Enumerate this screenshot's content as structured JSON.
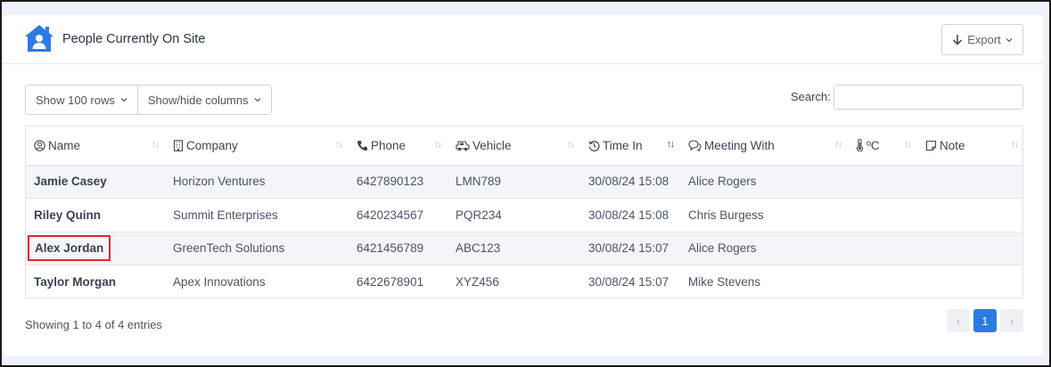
{
  "header": {
    "title": "People Currently On Site",
    "logo_icon": "house-person-icon",
    "export_label": "Export"
  },
  "toolbar": {
    "rows_label": "Show 100 rows",
    "columns_label": "Show/hide columns",
    "search_label": "Search:",
    "search_value": ""
  },
  "table": {
    "columns": [
      {
        "label": "Name",
        "icon": "person-circle-icon"
      },
      {
        "label": "Company",
        "icon": "building-icon"
      },
      {
        "label": "Phone",
        "icon": "phone-icon"
      },
      {
        "label": "Vehicle",
        "icon": "truck-icon"
      },
      {
        "label": "Time In",
        "icon": "history-icon"
      },
      {
        "label": "Meeting With",
        "icon": "chat-icon"
      },
      {
        "label": "ºC",
        "icon": "thermometer-icon"
      },
      {
        "label": "Note",
        "icon": "note-icon"
      }
    ],
    "rows": [
      {
        "name": "Jamie Casey",
        "company": "Horizon Ventures",
        "phone": "6427890123",
        "vehicle": "LMN789",
        "time_in": "30/08/24 15:08",
        "meeting_with": "Alice Rogers",
        "temp": "",
        "note": ""
      },
      {
        "name": "Riley Quinn",
        "company": "Summit Enterprises",
        "phone": "6420234567",
        "vehicle": "PQR234",
        "time_in": "30/08/24 15:08",
        "meeting_with": "Chris Burgess",
        "temp": "",
        "note": ""
      },
      {
        "name": "Alex Jordan",
        "company": "GreenTech Solutions",
        "phone": "6421456789",
        "vehicle": "ABC123",
        "time_in": "30/08/24 15:07",
        "meeting_with": "Alice Rogers",
        "temp": "",
        "note": ""
      },
      {
        "name": "Taylor Morgan",
        "company": "Apex Innovations",
        "phone": "6422678901",
        "vehicle": "XYZ456",
        "time_in": "30/08/24 15:07",
        "meeting_with": "Mike Stevens",
        "temp": "",
        "note": ""
      }
    ]
  },
  "footer": {
    "info": "Showing 1 to 4 of 4 entries",
    "prev": "‹",
    "current_page": "1",
    "next": "›"
  },
  "colors": {
    "accent": "#2c7be5",
    "highlight_border": "#d92a2a"
  }
}
